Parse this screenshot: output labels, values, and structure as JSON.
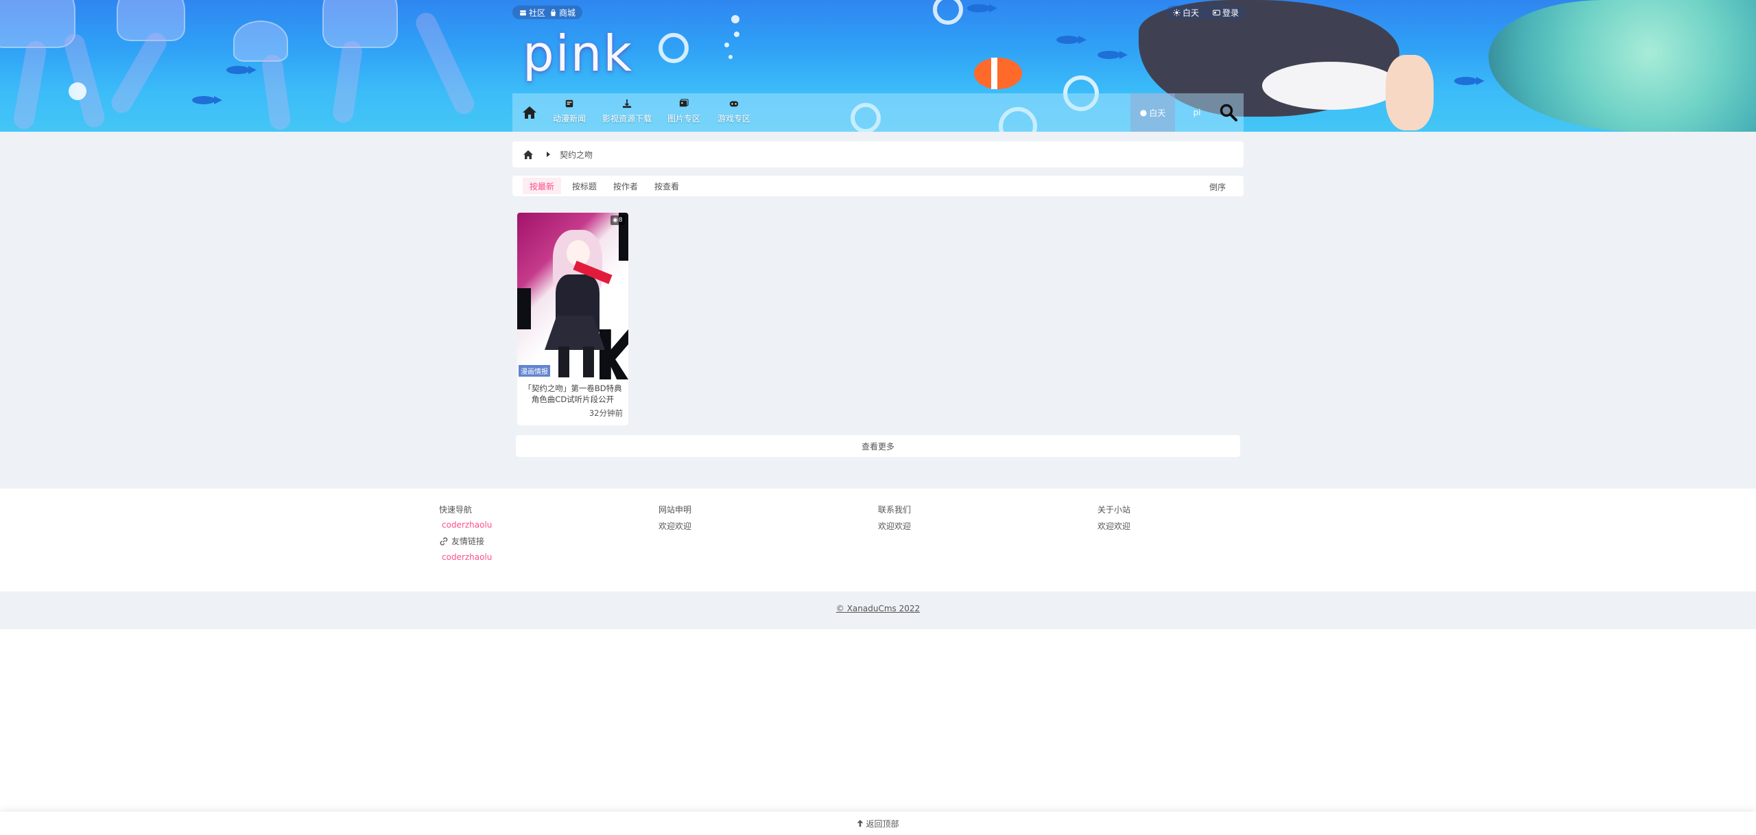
{
  "header": {
    "logo_text": "pink",
    "top_links": [
      {
        "label": "社区",
        "icon": "community-icon"
      },
      {
        "label": "商城",
        "icon": "shop-icon"
      }
    ],
    "top_right": [
      {
        "label": "白天",
        "icon": "sun-icon"
      },
      {
        "label": "登录",
        "icon": "login-icon"
      }
    ],
    "nav": [
      {
        "label": "动漫新闻",
        "icon": "news-icon"
      },
      {
        "label": "影视资源下载",
        "icon": "download-icon"
      },
      {
        "label": "图片专区",
        "icon": "image-icon"
      },
      {
        "label": "游戏专区",
        "icon": "game-icon"
      }
    ],
    "day_label": "白天",
    "user_label": "pi"
  },
  "breadcrumb": {
    "current": "契约之吻"
  },
  "sort": {
    "tabs": [
      "按最新",
      "按标题",
      "按作者",
      "按查看"
    ],
    "active_index": 0,
    "order_label": "倒序"
  },
  "posts": [
    {
      "category": "漫画情报",
      "views": "8",
      "title": "「契约之吻」第一卷BD特典角色曲CD试听片段公开",
      "time": "32分钟前"
    }
  ],
  "more_label": "查看更多",
  "footer": {
    "columns": [
      {
        "title": "快速导航",
        "link": "coderzhaolu",
        "friend_label": "友情链接",
        "friend_link": "coderzhaolu"
      },
      {
        "title": "网站申明",
        "text": "欢迎欢迎"
      },
      {
        "title": "联系我们",
        "text": "欢迎欢迎"
      },
      {
        "title": "关于小站",
        "text": "欢迎欢迎"
      }
    ],
    "copyright": "© XanaduCms 2022"
  },
  "back_to_top": "返回顶部",
  "colors": {
    "accent": "#ff4f8b",
    "page_bg": "#eef1f5",
    "banner_blue": "#2fa0f6"
  }
}
